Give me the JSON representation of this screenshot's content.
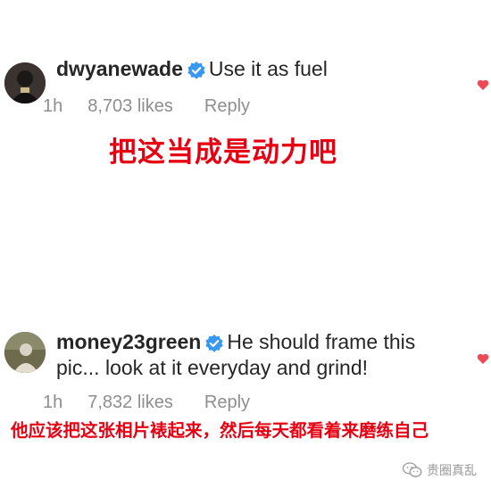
{
  "comments": [
    {
      "username": "dwyanewade",
      "text_line1": "Use it as fuel",
      "text_line2": "",
      "time": "1h",
      "likes": "8,703 likes",
      "reply": "Reply",
      "translation": "把这当成是动力吧"
    },
    {
      "username": "money23green",
      "text_line1": "He should frame this",
      "text_line2": "pic... look at it everyday and grind!",
      "time": "1h",
      "likes": "7,832 likes",
      "reply": "Reply",
      "translation": "他应该把这张相片裱起来，然后每天都看着来磨练自己"
    }
  ],
  "watermark": "贵圈真乱",
  "colors": {
    "verified": "#3897f0",
    "heart": "#ed4956",
    "translation": "#e60012",
    "meta": "#8e8e8e"
  },
  "icons": [
    "verified-badge-icon",
    "heart-icon",
    "wechat-logo-icon"
  ]
}
